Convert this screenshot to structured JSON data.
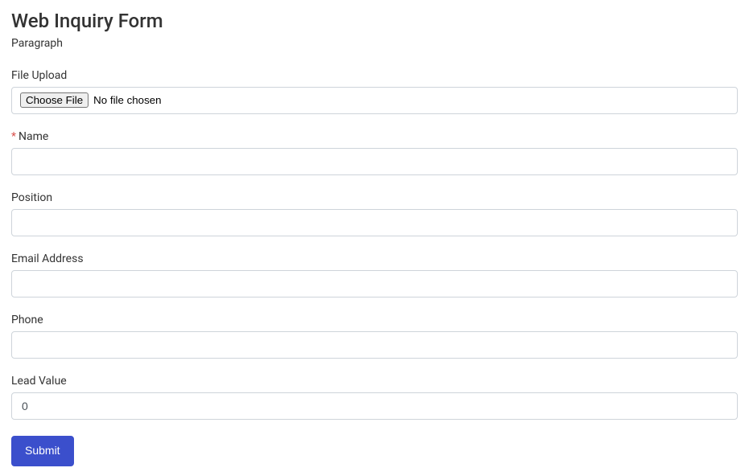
{
  "header": {
    "title": "Web Inquiry Form",
    "paragraph": "Paragraph"
  },
  "fields": {
    "file_upload": {
      "label": "File Upload",
      "button_label": "Choose File",
      "status_text": "No file chosen"
    },
    "name": {
      "label": "Name",
      "required_mark": "*",
      "value": ""
    },
    "position": {
      "label": "Position",
      "value": ""
    },
    "email": {
      "label": "Email Address",
      "value": ""
    },
    "phone": {
      "label": "Phone",
      "value": ""
    },
    "lead_value": {
      "label": "Lead Value",
      "value": "0"
    }
  },
  "actions": {
    "submit_label": "Submit"
  }
}
